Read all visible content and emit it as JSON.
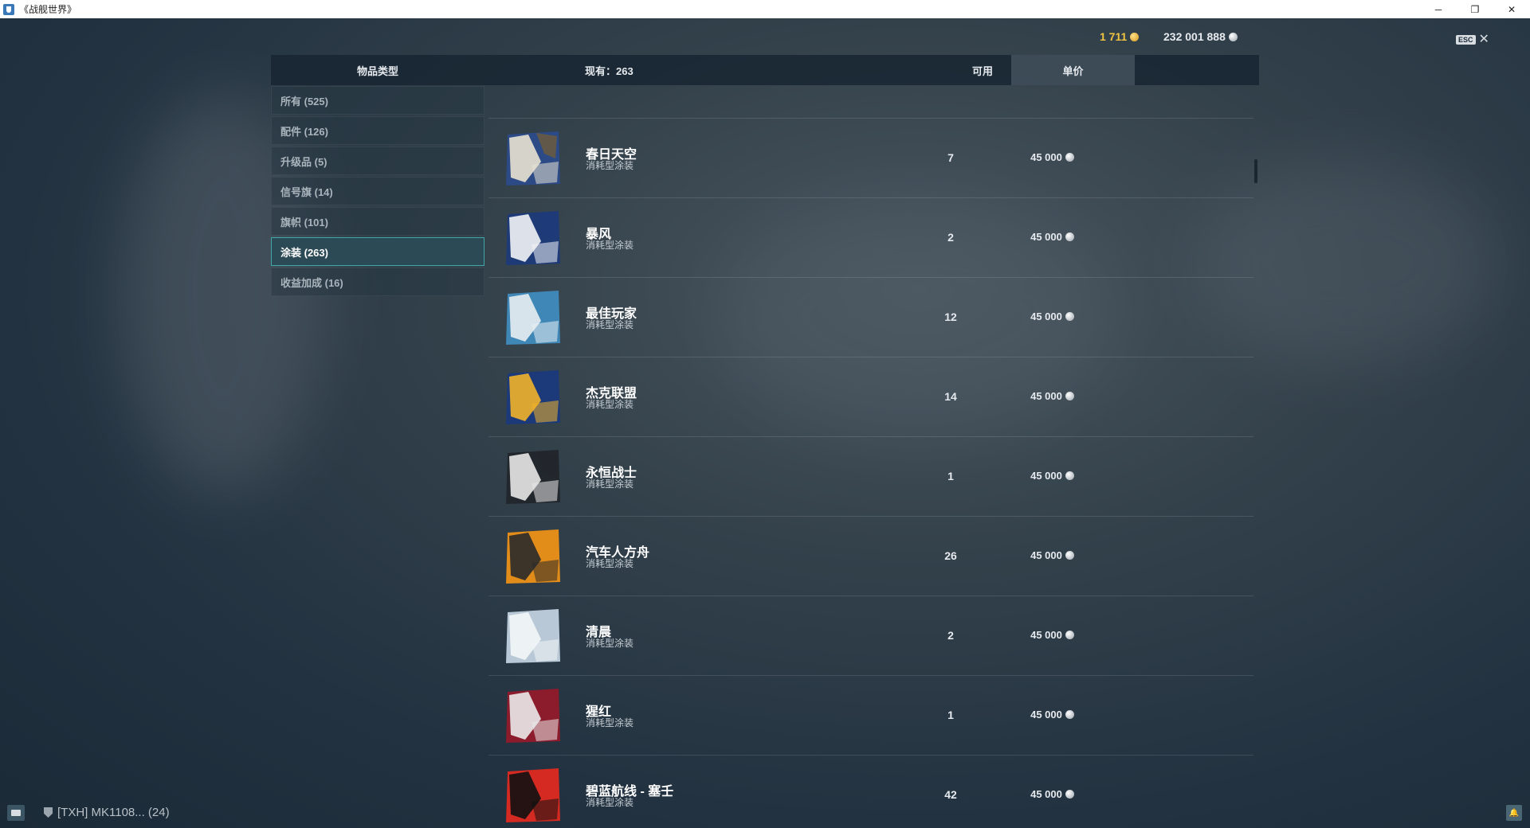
{
  "window": {
    "title": "《战舰世界》",
    "minimize_glyph": "─",
    "restore_glyph": "❐",
    "close_glyph": "✕"
  },
  "currency": {
    "gold": "1 711",
    "silver": "232 001 888"
  },
  "esc": {
    "label": "ESC",
    "close_glyph": "✕"
  },
  "header": {
    "type_label": "物品类型",
    "count_label": "现有：263",
    "available_label": "可用",
    "price_label": "单价"
  },
  "sidebar": {
    "items": [
      {
        "label": "所有 (525)"
      },
      {
        "label": "配件 (126)"
      },
      {
        "label": "升级品 (5)"
      },
      {
        "label": "信号旗 (14)"
      },
      {
        "label": "旗帜 (101)"
      },
      {
        "label": "涂装 (263)"
      },
      {
        "label": "收益加成 (16)"
      }
    ],
    "active_index": 5
  },
  "items": [
    {
      "name": "春日天空",
      "type": "消耗型涂装",
      "available": "7",
      "price": "45 000",
      "colors": [
        "#2c4a86",
        "#e8e2d2",
        "#6b5a3e"
      ]
    },
    {
      "name": "暴风",
      "type": "消耗型涂装",
      "available": "2",
      "price": "45 000",
      "colors": [
        "#1e3b78",
        "#f2f4f6"
      ]
    },
    {
      "name": "最佳玩家",
      "type": "消耗型涂装",
      "available": "12",
      "price": "45 000",
      "colors": [
        "#3f87b6",
        "#e9eef2"
      ]
    },
    {
      "name": "杰克联盟",
      "type": "消耗型涂装",
      "available": "14",
      "price": "45 000",
      "colors": [
        "#1c3a7a",
        "#f2b32a"
      ]
    },
    {
      "name": "永恒战士",
      "type": "消耗型涂装",
      "available": "1",
      "price": "45 000",
      "colors": [
        "#22272d",
        "#e8e8e8"
      ]
    },
    {
      "name": "汽车人方舟",
      "type": "消耗型涂装",
      "available": "26",
      "price": "45 000",
      "colors": [
        "#e28c1a",
        "#2a2a2a"
      ]
    },
    {
      "name": "清晨",
      "type": "消耗型涂装",
      "available": "2",
      "price": "45 000",
      "colors": [
        "#b8c8d6",
        "#f3f6f8"
      ]
    },
    {
      "name": "猩红",
      "type": "消耗型涂装",
      "available": "1",
      "price": "45 000",
      "colors": [
        "#8c1c2c",
        "#eaeaea"
      ]
    },
    {
      "name": "碧蓝航线 - 塞壬",
      "type": "消耗型涂装",
      "available": "42",
      "price": "45 000",
      "colors": [
        "#d42a22",
        "#111111"
      ]
    }
  ],
  "bottom": {
    "clan_text": "[TXH]  MK1108... (24)",
    "bell_glyph": "🔔"
  }
}
